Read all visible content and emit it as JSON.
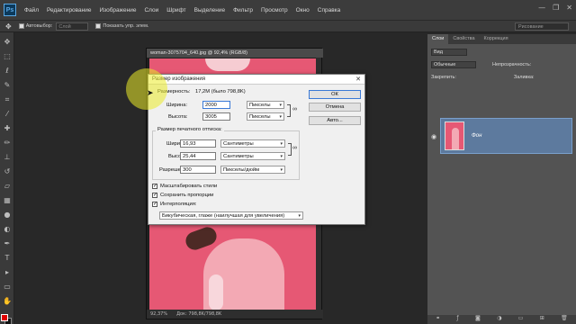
{
  "app": {
    "logo": "Ps"
  },
  "menu": [
    "Файл",
    "Редактирование",
    "Изображение",
    "Слои",
    "Шрифт",
    "Выделение",
    "Фильтр",
    "Просмотр",
    "Окно",
    "Справка"
  ],
  "window_controls": [
    "—",
    "❐",
    "✕"
  ],
  "options": {
    "autoselect_label": "Автовыбор:",
    "autoselect_value": "Слой",
    "show_controls_label": "Показать упр. элем.",
    "workspace": "Рисование"
  },
  "document": {
    "tab_title": "woman-3075704_640.jpg @ 92,4% (RGB/8)",
    "zoom": "92,37%",
    "doc_info": "Док: 798,8K/798,8K"
  },
  "panels": {
    "tabs": [
      "Слои",
      "Свойства",
      "Коррекция"
    ],
    "kind_label": "Вид",
    "blend_mode": "Обычные",
    "opacity_label": "Непрозрачность:",
    "lock_label": "Закрепить:",
    "fill_label": "Заливка:",
    "layer_name": "Фон"
  },
  "dialog": {
    "title": "Размер изображения",
    "dimensions_label": "Размерность:",
    "dimensions_value": "17,2M (было 798,8K)",
    "pixel_width_label": "Ширина:",
    "pixel_width_value": "2000",
    "pixel_width_unit": "Пикселы",
    "pixel_height_label": "Высота:",
    "pixel_height_value": "3005",
    "pixel_height_unit": "Пикселы",
    "print_group_title": "Размер печатного оттиска:",
    "print_width_label": "Ширина:",
    "print_width_value": "16,93",
    "print_width_unit": "Сантиметры",
    "print_height_label": "Высота:",
    "print_height_value": "25,44",
    "print_height_unit": "Сантиметры",
    "resolution_label": "Разрешение:",
    "resolution_value": "300",
    "resolution_unit": "Пикселы/дюйм",
    "scale_styles": "Масштабировать стили",
    "constrain": "Сохранить пропорции",
    "resample": "Интерполяция:",
    "resample_method": "Бикубическая, глаже (наилучшая для увеличения)",
    "ok": "ОК",
    "cancel": "Отмена",
    "auto": "Авто..."
  }
}
